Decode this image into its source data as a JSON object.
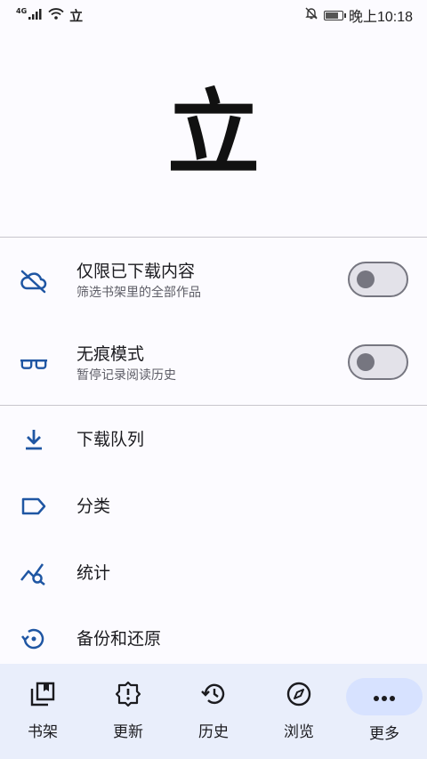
{
  "status_bar": {
    "signal_label": "4G",
    "app_glyph": "立",
    "time": "晚上10:18",
    "icons": [
      "signal-icon",
      "wifi-icon",
      "mute-icon",
      "battery-icon"
    ]
  },
  "logo": {
    "text": "立"
  },
  "toggles": [
    {
      "title": "仅限已下载内容",
      "subtitle": "筛选书架里的全部作品",
      "icon": "cloud-off-icon",
      "enabled": false
    },
    {
      "title": "无痕模式",
      "subtitle": "暂停记录阅读历史",
      "icon": "glasses-icon",
      "enabled": false
    }
  ],
  "menu": [
    {
      "label": "下载队列",
      "icon": "download-icon"
    },
    {
      "label": "分类",
      "icon": "label-icon"
    },
    {
      "label": "统计",
      "icon": "stats-icon"
    },
    {
      "label": "备份和还原",
      "icon": "restore-icon"
    }
  ],
  "bottom_nav": [
    {
      "label": "书架",
      "icon": "library-icon",
      "active": false
    },
    {
      "label": "更新",
      "icon": "updates-icon",
      "active": false
    },
    {
      "label": "历史",
      "icon": "history-icon",
      "active": false
    },
    {
      "label": "浏览",
      "icon": "compass-icon",
      "active": false
    },
    {
      "label": "更多",
      "icon": "more-icon",
      "active": true
    }
  ],
  "colors": {
    "accent": "#1f56a3",
    "background": "#fcfbff",
    "nav_background": "#e9eefb",
    "nav_active": "#d7e2ff"
  }
}
